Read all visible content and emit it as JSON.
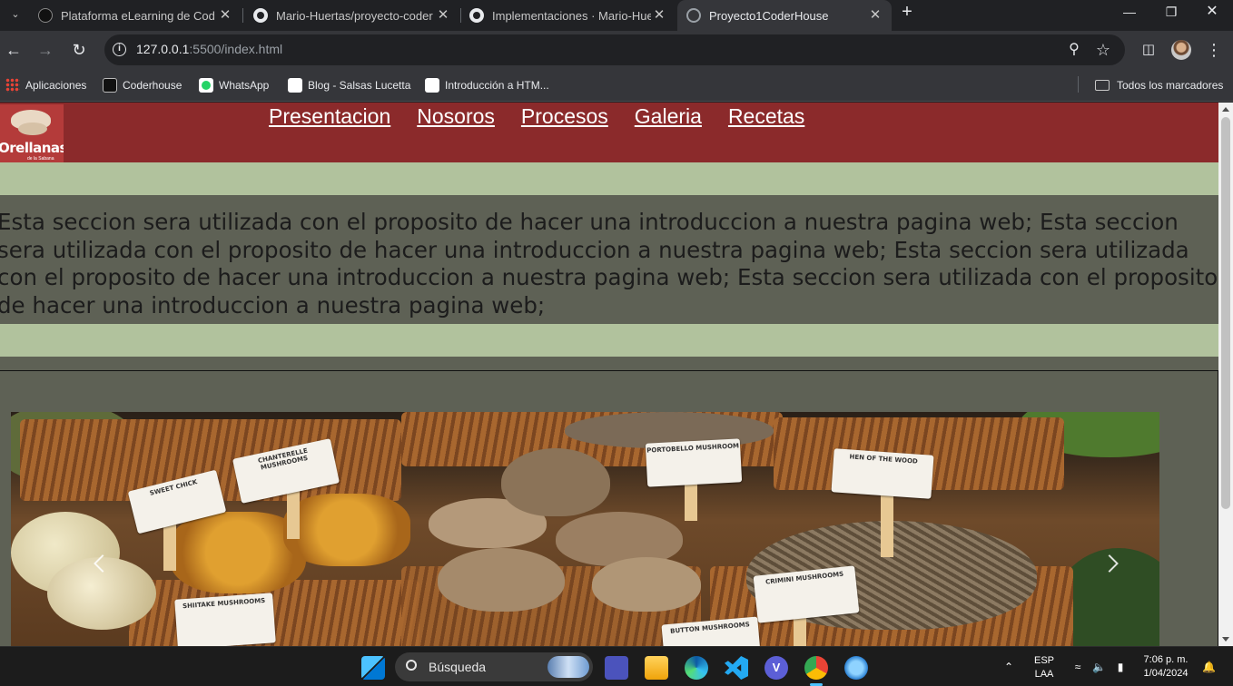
{
  "browser": {
    "tabs": [
      {
        "title": "Plataforma eLearning de Coderh",
        "icon": "coderhouse-icon",
        "active": false
      },
      {
        "title": "Mario-Huertas/proyecto-coder",
        "icon": "github-icon",
        "active": false
      },
      {
        "title": "Implementaciones · Mario-Huer",
        "icon": "github-icon",
        "active": false
      },
      {
        "title": "Proyecto1CoderHouse",
        "icon": "globe-icon",
        "active": true
      }
    ],
    "new_tab_label": "+",
    "url_host": "127.0.0.1",
    "url_rest": ":5500/index.html",
    "bookmarks": [
      {
        "label": "Aplicaciones",
        "icon": "apps-grid-icon"
      },
      {
        "label": "Coderhouse",
        "icon": "coderhouse-icon"
      },
      {
        "label": "WhatsApp",
        "icon": "whatsapp-icon"
      },
      {
        "label": "Blog - Salsas Lucetta",
        "icon": "blog-icon"
      },
      {
        "label": "Introducción a HTM...",
        "icon": "globe-icon"
      }
    ],
    "all_bookmarks_label": "Todos los marcadores"
  },
  "site": {
    "logo_text": "Orellanas",
    "logo_sub": "de la Sabana",
    "nav": [
      "Presentacion",
      "Nosoros",
      "Procesos",
      "Galeria",
      "Recetas"
    ],
    "intro_text": "Esta seccion sera utilizada con el proposito de hacer una introduccion a nuestra pagina web; Esta seccion sera utilizada con el proposito de hacer una introduccion a nuestra pagina web; Esta seccion sera utilizada con el proposito de hacer una introduccion a nuestra pagina web; Esta seccion sera utilizada con el proposito de hacer una introduccion a nuestra pagina web;",
    "carousel_labels": [
      "SWEET CHICK",
      "CHANTERELLE MUSHROOMS",
      "PORTOBELLO MUSHROOM",
      "HEN OF THE WOOD",
      "SHIITAKE MUSHROOMS",
      "CRIMINI MUSHROOMS",
      "BUTTON MUSHROOMS"
    ],
    "colors": {
      "header": "#8b2a2b",
      "band": "#b1c29d",
      "body": "#5e6155"
    }
  },
  "taskbar": {
    "search_placeholder": "Búsqueda",
    "lang_top": "ESP",
    "lang_bottom": "LAA",
    "time": "7:06 p. m.",
    "date": "1/04/2024"
  }
}
